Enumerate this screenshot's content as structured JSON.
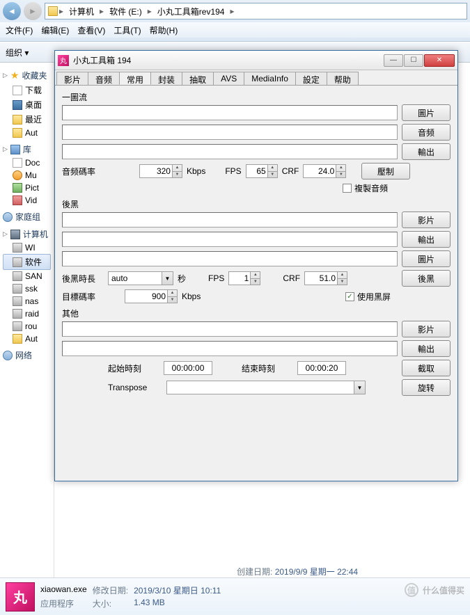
{
  "explorer": {
    "breadcrumb": [
      "计算机",
      "软件 (E:)",
      "小丸工具箱rev194"
    ],
    "menu": [
      "文件(F)",
      "编辑(E)",
      "查看(V)",
      "工具(T)",
      "帮助(H)"
    ],
    "toolbar": {
      "organize": "组织 ▾"
    }
  },
  "sidebar": {
    "favorites": {
      "header": "收藏夹",
      "items": [
        "下载",
        "桌面",
        "最近",
        "Aut"
      ]
    },
    "libraries": {
      "header": "库",
      "items": [
        "Doc",
        "Mu",
        "Pict",
        "Vid"
      ]
    },
    "homegroup": {
      "header": "家庭组"
    },
    "computer": {
      "header": "计算机",
      "items": [
        "WI",
        "软件",
        "SAN",
        "ssk",
        "nas",
        "raid",
        "rou",
        "Aut"
      ]
    },
    "network": {
      "header": "网络"
    }
  },
  "details": {
    "filename": "xiaowan.exe",
    "type_label": "应用程序",
    "mod_label": "修改日期:",
    "mod_val": "2019/3/10 星期日 10:11",
    "create_label": "创建日期:",
    "create_val": "2019/9/9 星期一 22:44",
    "size_label": "大小:",
    "size_val": "1.43 MB"
  },
  "dialog": {
    "title": "小丸工具箱 194",
    "tabs": [
      "影片",
      "音频",
      "常用",
      "封装",
      "抽取",
      "AVS",
      "MediaInfo",
      "設定",
      "帮助"
    ],
    "active_tab": 2,
    "section1": {
      "title": "一圖流",
      "btn_image": "圖片",
      "btn_audio": "音频",
      "btn_output": "輸出",
      "btn_compress": "壓制",
      "bitrate_label": "音频碼率",
      "bitrate_val": "320",
      "bitrate_unit": "Kbps",
      "fps_label": "FPS",
      "fps_val": "65",
      "crf_label": "CRF",
      "crf_val": "24.0",
      "copy_audio": "複製音頻"
    },
    "section2": {
      "title": "後黑",
      "btn_video": "影片",
      "btn_output": "輸出",
      "btn_image": "圖片",
      "btn_black": "後黑",
      "duration_label": "後黑時長",
      "duration_val": "auto",
      "duration_unit": "秒",
      "fps_label": "FPS",
      "fps_val": "1",
      "crf_label": "CRF",
      "crf_val": "51.0",
      "target_label": "目標碼率",
      "target_val": "900",
      "target_unit": "Kbps",
      "use_black": "使用黑屏"
    },
    "section3": {
      "title": "其他",
      "btn_video": "影片",
      "btn_output": "輸出",
      "btn_extract": "截取",
      "btn_rotate": "旋转",
      "start_label": "起始時刻",
      "start_val": "00:00:00",
      "end_label": "结束時刻",
      "end_val": "00:00:20",
      "transpose_label": "Transpose"
    }
  },
  "watermark": "什么值得买"
}
